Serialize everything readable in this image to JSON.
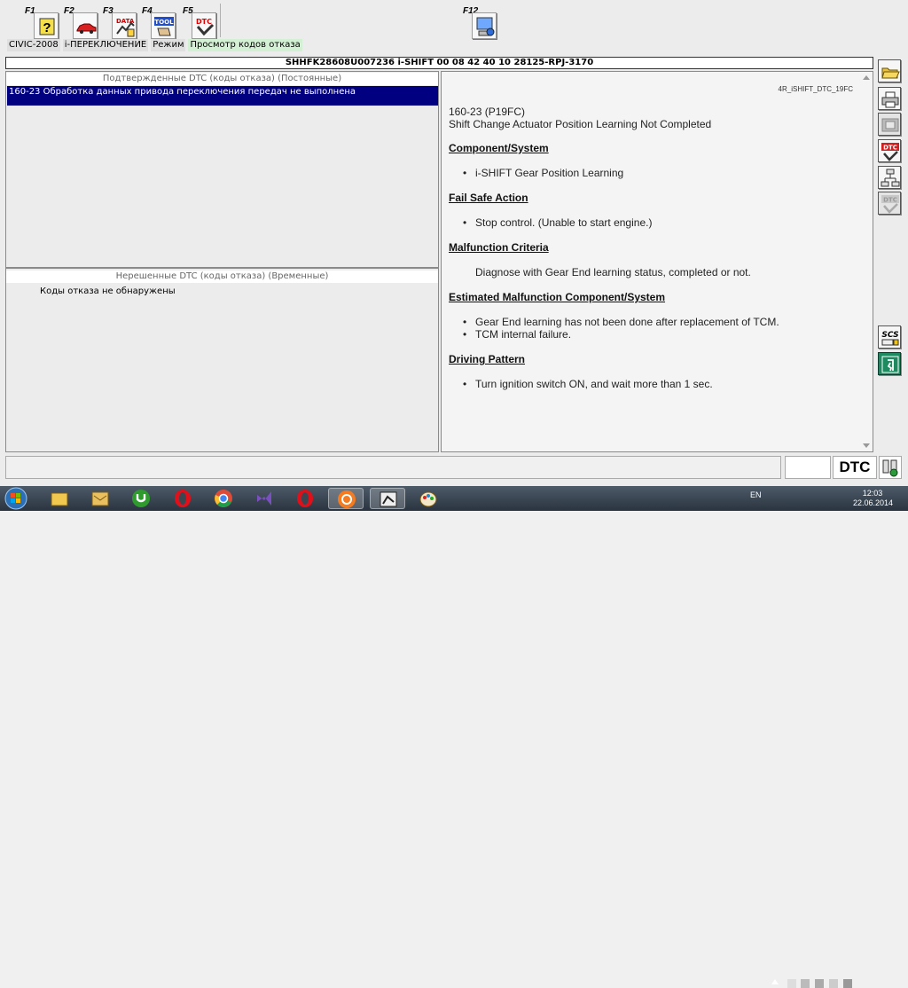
{
  "toolbar": {
    "keys": [
      {
        "key": "F1",
        "icon": "help-icon"
      },
      {
        "key": "F2",
        "icon": "car-icon"
      },
      {
        "key": "F3",
        "icon": "data-icon"
      },
      {
        "key": "F4",
        "icon": "tool-icon"
      },
      {
        "key": "F5",
        "icon": "dtc-icon"
      },
      {
        "key": "F12",
        "icon": "screen-capture-icon"
      }
    ],
    "f3_text": "DATA",
    "f4_text": "TOOL",
    "f5_text": "DTC"
  },
  "breadcrumb": [
    "CIVIC-2008",
    "i-ПЕРЕКЛЮЧЕНИЕ",
    "Режим",
    "Просмотр кодов отказа"
  ],
  "vehicle_header": "SHHFK28608U007236  i-SHIFT  00 08 42 40 10  28125-RPJ-3170",
  "confirmed_panel": {
    "title": "Подтвержденные DTC (коды отказа) (Постоянные)",
    "rows": [
      "160-23 Обработка данных привода переключения передач не выполнена"
    ]
  },
  "pending_panel": {
    "title": "Нерешенные DTC (коды отказа) (Временные)",
    "empty_text": "Коды отказа не обнаружены"
  },
  "detail": {
    "doc_id": "4R_iSHIFT_DTC_19FC",
    "code": "160-23 (P19FC)",
    "title": "Shift Change Actuator Position Learning Not Completed",
    "component_heading": "Component/System",
    "component_items": [
      "i-SHIFT Gear Position Learning"
    ],
    "failsafe_heading": "Fail Safe Action",
    "failsafe_items": [
      "Stop control. (Unable to start engine.)"
    ],
    "criteria_heading": "Malfunction Criteria",
    "criteria_text": "Diagnose with Gear End learning status, completed or not.",
    "estimated_heading": "Estimated Malfunction Component/System",
    "estimated_items": [
      "Gear End learning has not been done after replacement of TCM.",
      "TCM internal failure."
    ],
    "driving_heading": "Driving Pattern",
    "driving_items": [
      "Turn ignition switch ON, and wait more than 1 sec."
    ]
  },
  "sidebar": {
    "icons": [
      "open-folder-icon",
      "print-icon",
      "film-icon",
      "dtc-clear-icon",
      "tree-icon",
      "dtc-disabled-icon",
      "scs-icon",
      "exit-icon"
    ],
    "scs_text": "SCS",
    "dtc_text": "DTC"
  },
  "status": {
    "mode_label": "DTC"
  },
  "taskbar": {
    "apps": [
      "windows-start-icon",
      "explorer-icon",
      "mail-icon",
      "utorrent-icon",
      "opera-icon",
      "chrome-icon",
      "visual-studio-icon",
      "opera-icon",
      "avast-icon",
      "hds-icon",
      "paint-icon"
    ],
    "lang": "EN",
    "time": "12:03",
    "date": "22.06.2014"
  }
}
